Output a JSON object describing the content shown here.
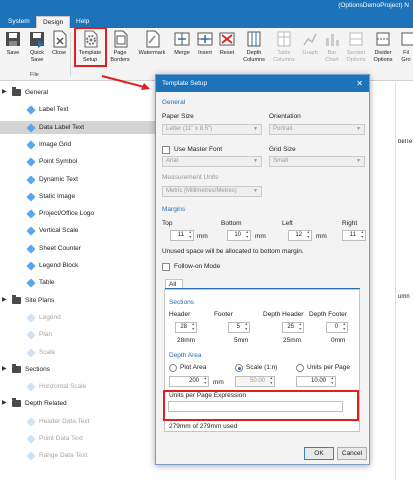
{
  "window": {
    "title": "(OptionsDemoProject) N"
  },
  "menu": {
    "tabs": [
      "System",
      "Design",
      "Help"
    ]
  },
  "ribbon": {
    "buttons": [
      {
        "label": "Save",
        "icon": "save-icon",
        "disabled": false
      },
      {
        "label": "Quick Save",
        "icon": "quick-save-icon",
        "disabled": false
      },
      {
        "label": "Close",
        "icon": "close-file-icon",
        "disabled": false
      },
      {
        "label": "Template Setup",
        "icon": "gear-icon",
        "disabled": false
      },
      {
        "label": "Page Borders",
        "icon": "page-borders-icon",
        "disabled": false
      },
      {
        "label": "Watermark",
        "icon": "watermark-icon",
        "disabled": false
      },
      {
        "label": "Merge",
        "icon": "merge-icon",
        "disabled": false
      },
      {
        "label": "Insert",
        "icon": "insert-icon",
        "disabled": false
      },
      {
        "label": "Reset",
        "icon": "reset-icon",
        "disabled": false
      },
      {
        "label": "Depth Columns",
        "icon": "depth-columns-icon",
        "disabled": false
      },
      {
        "label": "Table Columns",
        "icon": "table-columns-icon",
        "disabled": true
      },
      {
        "label": "Graph",
        "icon": "graph-icon",
        "disabled": true
      },
      {
        "label": "Bar Chart",
        "icon": "bar-chart-icon",
        "disabled": true
      },
      {
        "label": "Section Options",
        "icon": "section-options-icon",
        "disabled": true
      },
      {
        "label": "Divider Options",
        "icon": "divider-options-icon",
        "disabled": false
      },
      {
        "label": "Fil Gro",
        "icon": "fill-icon",
        "disabled": false
      }
    ],
    "group_label": "File"
  },
  "tree": {
    "items": [
      {
        "label": "General",
        "type": "folder"
      },
      {
        "label": "Label Text",
        "type": "item"
      },
      {
        "label": "Data Label Text",
        "type": "item",
        "selected": true
      },
      {
        "label": "Image Grid",
        "type": "item"
      },
      {
        "label": "Point Symbol",
        "type": "item"
      },
      {
        "label": "Dynamic Text",
        "type": "item"
      },
      {
        "label": "Static Image",
        "type": "item"
      },
      {
        "label": "Project/Office Logo",
        "type": "item"
      },
      {
        "label": "Vertical Scale",
        "type": "item"
      },
      {
        "label": "Sheet Counter",
        "type": "item"
      },
      {
        "label": "Legend Block",
        "type": "item"
      },
      {
        "label": "Table",
        "type": "item"
      },
      {
        "label": "Site Plans",
        "type": "folder"
      },
      {
        "label": "Legend",
        "type": "item",
        "disabled": true
      },
      {
        "label": "Plan",
        "type": "item",
        "disabled": true
      },
      {
        "label": "Scale",
        "type": "item",
        "disabled": true
      },
      {
        "label": "Sections",
        "type": "folder"
      },
      {
        "label": "Horizontal Scale",
        "type": "item",
        "disabled": true
      },
      {
        "label": "Depth Related",
        "type": "folder"
      },
      {
        "label": "Header Data Text",
        "type": "item",
        "disabled": true
      },
      {
        "label": "Point Data Text",
        "type": "item",
        "disabled": true
      },
      {
        "label": "Range Data Text",
        "type": "item",
        "disabled": true
      }
    ]
  },
  "background": {
    "label_text_fragment": "belTe",
    "column_fragment": "umn"
  },
  "dialog": {
    "title": "Template Setup",
    "general": {
      "heading": "General",
      "paper_size_label": "Paper Size",
      "paper_size_value": "Letter (11\" x 8.5\")",
      "orientation_label": "Orientation",
      "orientation_value": "Portrait",
      "use_master_font": "Use Master Font",
      "font_value": "Arial",
      "grid_size_label": "Grid Size",
      "grid_size_value": "Small",
      "measurement_label": "Measurement Units",
      "measurement_value": "Metric (Millimetres/Metres)"
    },
    "margins": {
      "heading": "Margins",
      "top_label": "Top",
      "top_value": "11",
      "bottom_label": "Bottom",
      "bottom_value": "10",
      "left_label": "Left",
      "left_value": "12",
      "right_label": "Right",
      "right_value": "11",
      "unit": "mm",
      "note": "Unused space will be allocated to bottom margin.",
      "follow_on": "Follow-on Mode"
    },
    "tab": "All",
    "sections": {
      "heading": "Sections",
      "header_label": "Header",
      "header_value": "28",
      "header_mm": "28mm",
      "footer_label": "Footer",
      "footer_value": "5",
      "footer_mm": "5mm",
      "depth_header_label": "Depth Header",
      "depth_header_value": "25",
      "depth_header_mm": "25mm",
      "depth_footer_label": "Depth Footer",
      "depth_footer_value": "0",
      "depth_footer_mm": "0mm"
    },
    "depth_area": {
      "heading": "Depth Area",
      "plot_area": "Plot Area",
      "plot_value": "200",
      "plot_unit": "mm",
      "scale": "Scale (1:n)",
      "scale_value": "50.00",
      "units_per_page": "Units per Page",
      "units_value": "10.00",
      "expression_label": "Units per Page Expression",
      "used_note": "279mm of 279mm used"
    },
    "ok": "OK",
    "cancel": "Cancel"
  }
}
